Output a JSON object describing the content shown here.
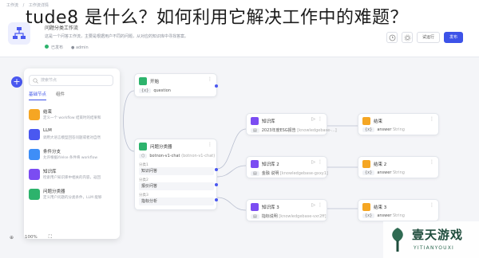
{
  "overlay_title": "tude8 是什么？如何利用它解决工作中的难题？",
  "header": {
    "breadcrumbs": [
      "工作流",
      "/",
      "工作流详情"
    ],
    "app_name": "问题分类工作流",
    "app_desc": "这是一个问答工作流，主要是根据用户不同的问题，从对应的知识库中寻找答案。",
    "status": "已发布",
    "owner": "admin",
    "actions": {
      "test_run": "试运行",
      "publish": "发布"
    }
  },
  "panel": {
    "search_placeholder": "搜索节点",
    "tabs": [
      "基础节点",
      "组件"
    ],
    "items": [
      {
        "title": "结束",
        "desc": "定义一个 workflow 结束时的结果和",
        "color": "#f5a623"
      },
      {
        "title": "LLM",
        "desc": "调用大语言模型回答问题或者对自然",
        "color": "#4a58f0"
      },
      {
        "title": "条件分支",
        "desc": "允许根据if/else 条件将 workflow",
        "color": "#3e8ef7"
      },
      {
        "title": "知识库",
        "desc": "检索用户知识库中相关的内容，返回",
        "color": "#7b4cf2"
      },
      {
        "title": "问题分类器",
        "desc": "定义用户问题的分类条件，LLM 能够",
        "color": "#2db36c"
      }
    ]
  },
  "nodes": {
    "start": {
      "title": "开始",
      "var": "question"
    },
    "classifier": {
      "title": "问题分类器",
      "model_tag": "botnon-v1-chat",
      "model_hint": "(botnon-v1-chat)",
      "cls1_label": "分类1",
      "cls1": "知识问答",
      "cls2_label": "分类2",
      "cls2": "报价问答",
      "cls3_label": "分类3",
      "cls3": "指标分析"
    },
    "kb1": {
      "title": "知识库",
      "row": "2023年度ESG报告",
      "hint": "[knowledgebase-...]"
    },
    "kb2": {
      "title": "知识库 2",
      "row": "金融 说明",
      "hint": "[knowledgebase-gxxy1]"
    },
    "kb3": {
      "title": "知识库 3",
      "row": "指标说明",
      "hint": "[knowledgebase-vxr2ff]"
    },
    "end1": {
      "title": "结束",
      "var": "answer",
      "hint": "String"
    },
    "end2": {
      "title": "结束 2",
      "var": "answer",
      "hint": "String"
    },
    "end3": {
      "title": "结束 3",
      "var": "answer",
      "hint": "String"
    }
  },
  "bottom": {
    "zoom": "100%"
  },
  "watermark": {
    "cn": "壹天游戏",
    "en": "YITIANYOUXI"
  }
}
